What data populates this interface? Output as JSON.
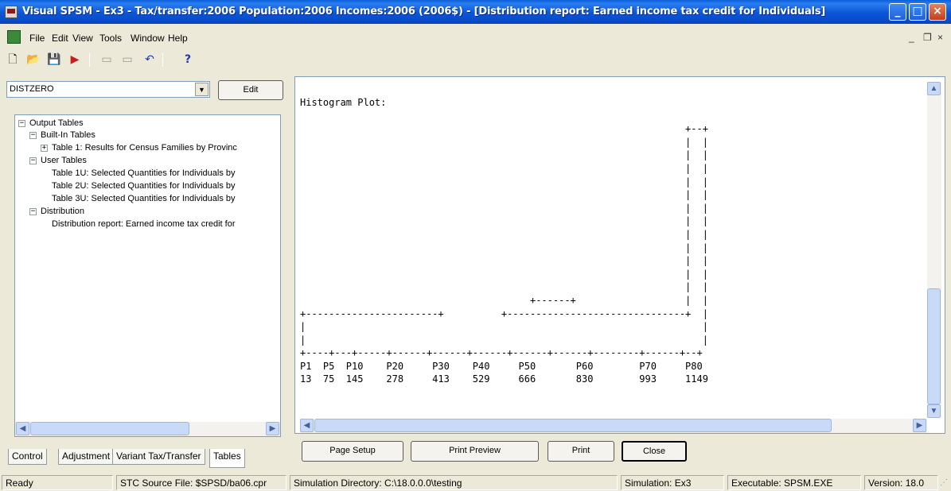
{
  "window": {
    "title": "Visual SPSM - Ex3 - Tax/transfer:2006 Population:2006 Incomes:2006 (2006$) - [Distribution report: Earned income tax credit for Individuals]",
    "minimize": "_",
    "maximize": "□",
    "close": "×"
  },
  "menu": {
    "items": [
      "File",
      "Edit",
      "View",
      "Tools",
      "Window",
      "Help"
    ],
    "mdi_minimize": "_",
    "mdi_restore": "❐",
    "mdi_close": "×"
  },
  "toolbar": {
    "new": "🗋",
    "open": "📂",
    "save": "💾",
    "run": "▶",
    "tool5": "▭",
    "tool6": "▭",
    "undo": "↶",
    "help": "?"
  },
  "left": {
    "combo_value": "DISTZERO",
    "edit_label": "Edit",
    "tree": [
      {
        "label": "Output Tables",
        "expander": "−"
      },
      {
        "label": "Built-In Tables",
        "expander": "−"
      },
      {
        "label": "Table 1: Results for Census Families by Provinc",
        "expander": "+"
      },
      {
        "label": "User Tables",
        "expander": "−"
      },
      {
        "label": "Table 1U: Selected Quantities for Individuals by",
        "expander": ""
      },
      {
        "label": "Table 2U: Selected Quantities for Individuals by",
        "expander": ""
      },
      {
        "label": "Table 3U: Selected Quantities for Individuals by",
        "expander": ""
      },
      {
        "label": "Distribution",
        "expander": "−"
      },
      {
        "label": "Distribution report: Earned income tax credit for",
        "expander": ""
      }
    ],
    "tabs": [
      "Control",
      "Adjustment",
      "Variant Tax/Transfer",
      "Tables"
    ]
  },
  "report": {
    "heading": "Histogram Plot:",
    "lines": [
      "",
      "                                                                   +--+",
      "                                                                   |  |",
      "                                                                   |  |",
      "                                                                   |  |",
      "                                                                   |  |",
      "                                                                   |  |",
      "                                                                   |  |",
      "                                                                   |  |",
      "                                                                   |  |",
      "                                                                   |  |",
      "                                                                   |  |",
      "                                                                   |  |",
      "                                                                   |  |",
      "                                        +------+                   |  |",
      "+-----------------------+          +-------------------------------+  |",
      "|                                                                     |",
      "|                                                                     |",
      "+----+---+-----+------+------+------+------+------+--------+------+--+",
      "P1  P5  P10    P20     P30    P40     P50       P60        P70     P80",
      "13  75  145    278     413    529     666       830        993     1149"
    ]
  },
  "buttons": {
    "page_setup": "Page Setup",
    "print_preview": "Print Preview",
    "print": "Print",
    "close": "Close"
  },
  "status": {
    "ready": "Ready",
    "source": "STC Source File: $SPSD/ba06.cpr",
    "directory": "Simulation Directory: C:\\18.0.0.0\\testing",
    "simulation": "Simulation: Ex3",
    "executable": "Executable: SPSM.EXE",
    "version": "Version: 18.0"
  }
}
